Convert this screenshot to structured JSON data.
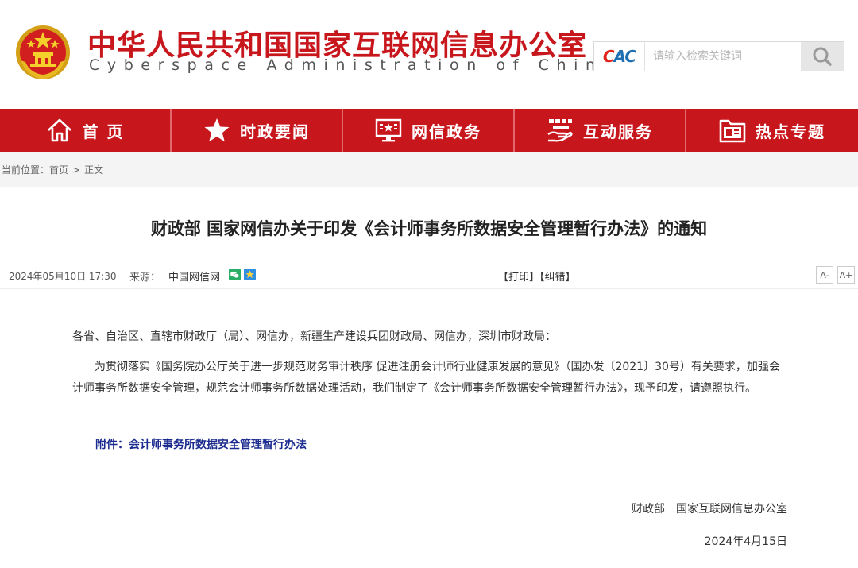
{
  "header": {
    "title": "中华人民共和国国家互联网信息办公室",
    "subtitle": "Cyberspace Administration of China",
    "brand_color": "#c8161d"
  },
  "search": {
    "logo_text": "CAC",
    "placeholder": "请输入检索关键词",
    "button_icon": "search-icon"
  },
  "nav": {
    "items": [
      {
        "label": "首 页",
        "icon": "home-icon"
      },
      {
        "label": "时政要闻",
        "icon": "star-icon"
      },
      {
        "label": "网信政务",
        "icon": "monitor-icon"
      },
      {
        "label": "互动服务",
        "icon": "hand-service-icon"
      },
      {
        "label": "热点专题",
        "icon": "folder-icon"
      }
    ]
  },
  "breadcrumb": {
    "prefix": "当前位置：",
    "home": "首页",
    "separator": ">",
    "current": "正文"
  },
  "article": {
    "title": "财政部 国家网信办关于印发《会计师事务所数据安全管理暂行办法》的通知",
    "date": "2024年05月10日 17:30",
    "source_label": "来源：",
    "source": "中国网信网",
    "print": "【打印】",
    "correct": "【纠错】",
    "font_smaller": "A-",
    "font_larger": "A+",
    "salutation": "各省、自治区、直辖市财政厅（局）、网信办，新疆生产建设兵团财政局、网信办，深圳市财政局：",
    "paragraph": "为贯彻落实《国务院办公厅关于进一步规范财务审计秩序 促进注册会计师行业健康发展的意见》（国办发〔2021〕30号）有关要求，加强会计师事务所数据安全管理，规范会计师事务所数据处理活动，我们制定了《会计师事务所数据安全管理暂行办法》，现予印发，请遵照执行。",
    "attachment_label": "附件：",
    "attachment_link": "会计师事务所数据安全管理暂行办法",
    "signatories": "财政部　国家互联网信息办公室",
    "sign_date": "2024年4月15日"
  }
}
